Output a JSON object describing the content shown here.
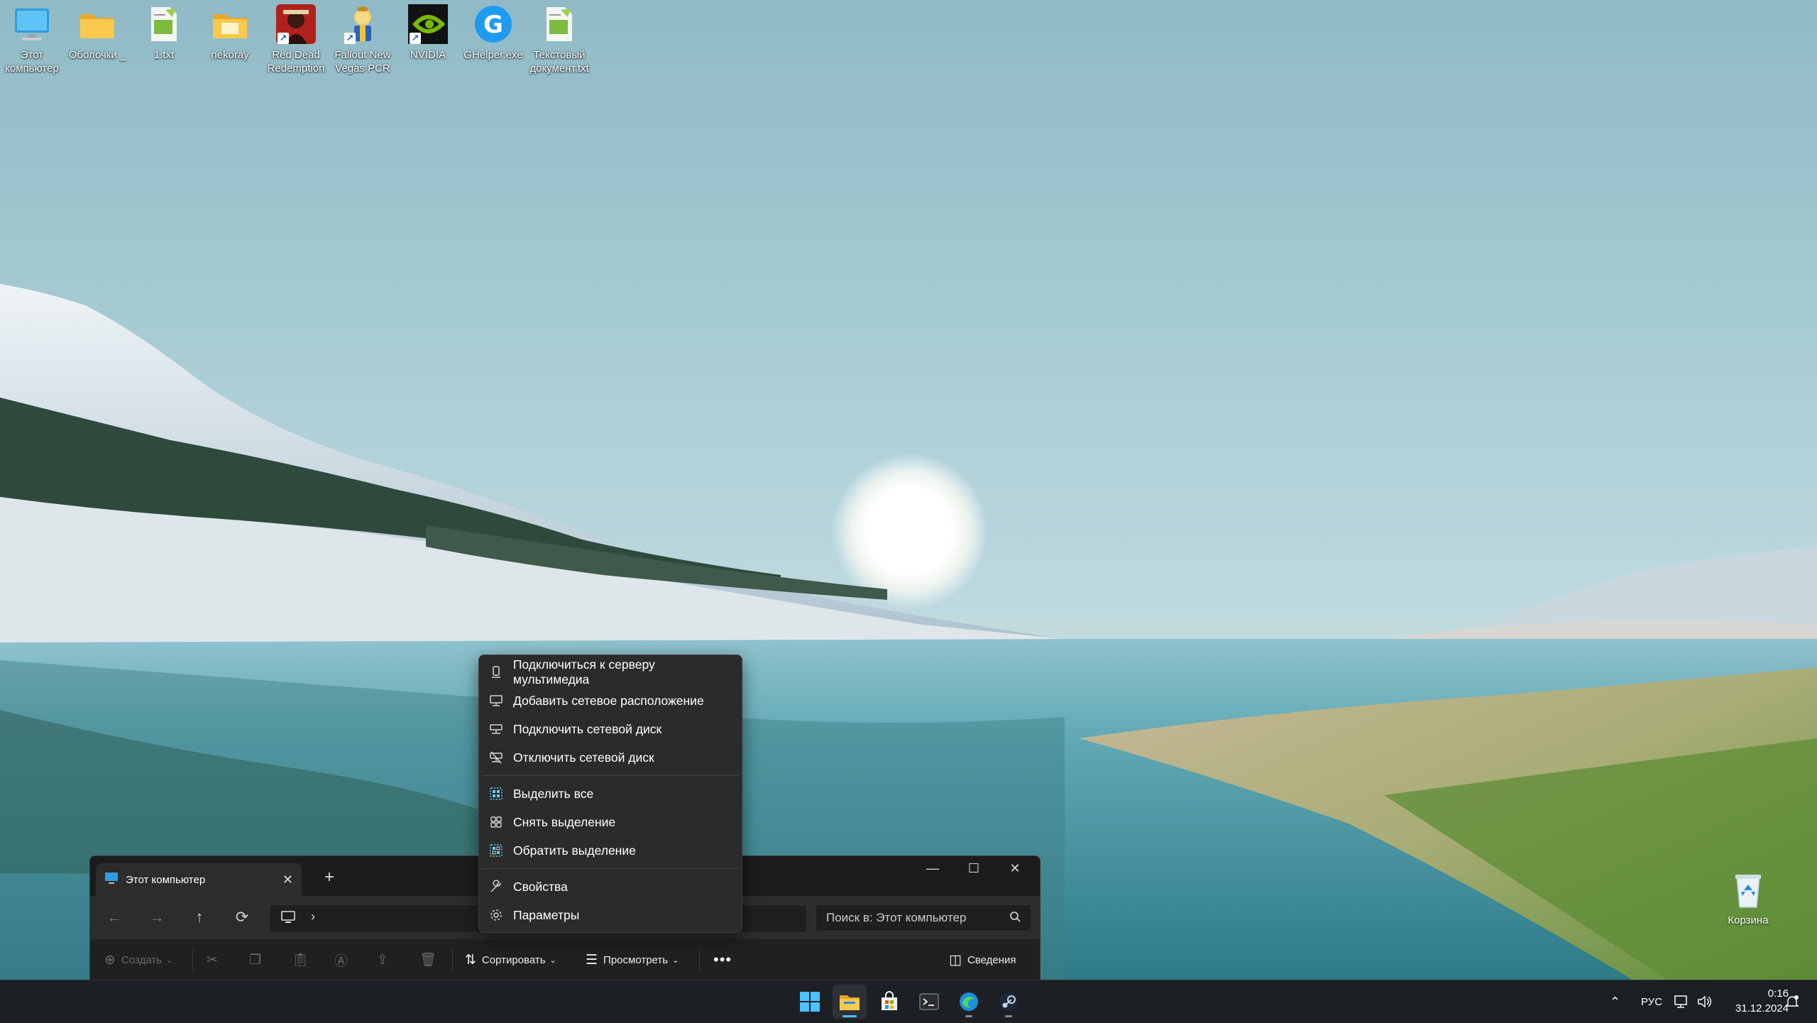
{
  "desktop": {
    "icons": [
      {
        "label": "Этот компьютер",
        "icon": "computer-icon"
      },
      {
        "label": "Оболочки _",
        "icon": "folder-icon"
      },
      {
        "label": "1.txt",
        "icon": "text-file-icon"
      },
      {
        "label": "nekoray",
        "icon": "folder-icon"
      },
      {
        "label": "Red Dead Redemption",
        "icon": "game-shortcut-icon"
      },
      {
        "label": "Fallout New Vegas PCR",
        "icon": "game-shortcut-icon"
      },
      {
        "label": "NVIDIA",
        "icon": "nvidia-icon"
      },
      {
        "label": "GHelper.exe",
        "icon": "ghelper-icon"
      },
      {
        "label": "Текстовый документ.txt",
        "icon": "text-file-icon"
      }
    ],
    "recycle_bin": {
      "label": "Корзина",
      "icon": "recycle-bin-icon"
    }
  },
  "explorer": {
    "tab_title": "Этот компьютер",
    "search_placeholder": "Поиск в: Этот компьютер",
    "toolbar": {
      "create_label": "Создать",
      "sort_label": "Сортировать",
      "view_label": "Просмотреть",
      "details_label": "Сведения"
    }
  },
  "context_menu": {
    "items": [
      {
        "label": "Подключиться к серверу мультимедиа",
        "icon": "media-server-icon"
      },
      {
        "label": "Добавить сетевое расположение",
        "icon": "network-location-icon"
      },
      {
        "label": "Подключить сетевой диск",
        "icon": "map-drive-icon"
      },
      {
        "label": "Отключить сетевой диск",
        "icon": "disconnect-drive-icon"
      },
      {
        "label": "Выделить все",
        "icon": "select-all-icon"
      },
      {
        "label": "Снять выделение",
        "icon": "select-none-icon"
      },
      {
        "label": "Обратить выделение",
        "icon": "invert-selection-icon"
      },
      {
        "label": "Свойства",
        "icon": "properties-icon"
      },
      {
        "label": "Параметры",
        "icon": "options-icon"
      }
    ]
  },
  "taskbar": {
    "apps": [
      "start-icon",
      "file-explorer-icon",
      "store-icon",
      "terminal-icon",
      "edge-icon",
      "steam-icon"
    ],
    "language": "РУС",
    "time": "0:16",
    "date": "31.12.2024"
  },
  "colors": {
    "menu_bg": "#2b2b2b",
    "window_bg": "#202020",
    "taskbar_bg": "#1c2024",
    "accent": "#60cdff"
  }
}
